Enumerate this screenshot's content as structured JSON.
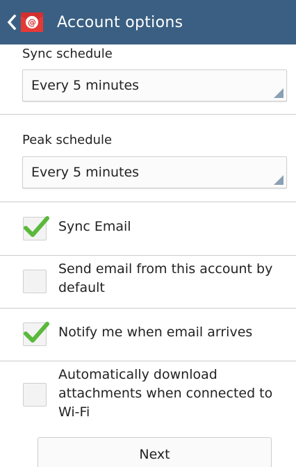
{
  "action_bar": {
    "title": "Account options",
    "back_icon": "chevron-left-icon",
    "app_icon": "email-icon",
    "bar_color": "#3a5f82",
    "app_icon_color": "#d32f2f"
  },
  "sync_schedule": {
    "label": "Sync schedule",
    "value": "Every 5 minutes"
  },
  "peak_schedule": {
    "label": "Peak schedule",
    "value": "Every 5 minutes"
  },
  "options": [
    {
      "label": "Sync Email",
      "checked": true
    },
    {
      "label": "Send email from this account by default",
      "checked": false
    },
    {
      "label": "Notify me when email arrives",
      "checked": true
    },
    {
      "label": "Automatically download attachments when connected to Wi-Fi",
      "checked": false
    }
  ],
  "footer": {
    "next_label": "Next"
  },
  "colors": {
    "check_green": "#5ab93b",
    "divider": "#cccccc"
  }
}
